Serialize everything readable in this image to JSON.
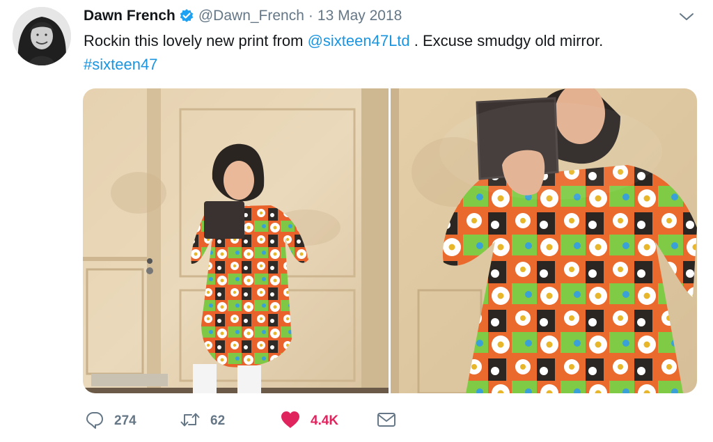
{
  "tweet": {
    "author": {
      "display_name": "Dawn French",
      "handle": "@Dawn_French",
      "verified": true
    },
    "separator": "·",
    "date": "13 May 2018",
    "text": {
      "part1": "Rockin this lovely new print from ",
      "mention": "@sixteen47Ltd",
      "part2": " . Excuse smudgy old mirror.",
      "hashtag": "#sixteen47"
    },
    "media": {
      "photo_count": 2
    },
    "actions": {
      "reply_count": "274",
      "retweet_count": "62",
      "like_count": "4.4K",
      "liked": true
    }
  },
  "icons": {
    "verified": "verified-badge-icon",
    "caret": "chevron-down-icon",
    "reply": "reply-icon",
    "retweet": "retweet-icon",
    "like": "heart-icon",
    "dm": "envelope-icon"
  },
  "colors": {
    "link": "#1b95e0",
    "secondary_text": "#657786",
    "like_active": "#e0245e",
    "primary_text": "#14171a"
  }
}
